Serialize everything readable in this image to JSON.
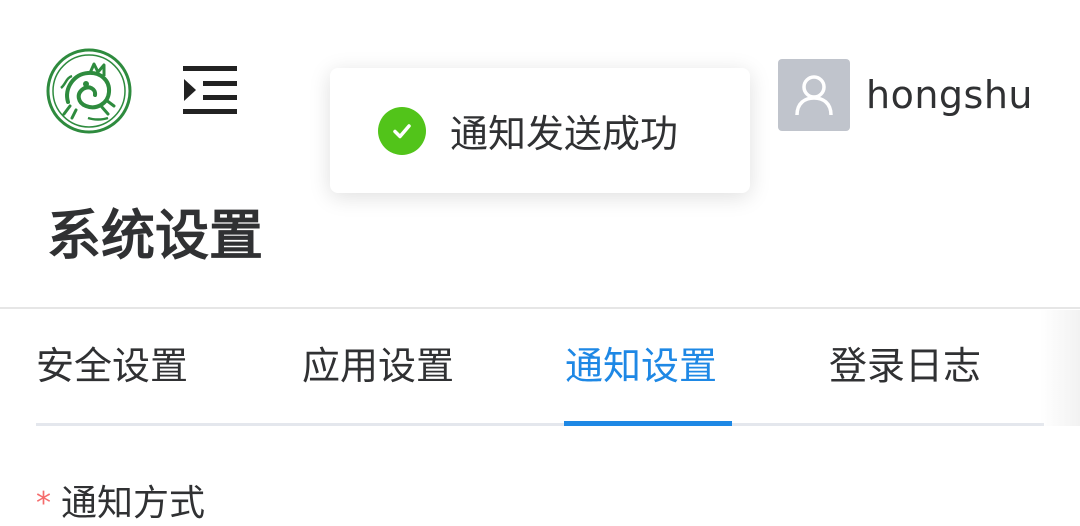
{
  "header": {
    "logo_icon": "dragon-emblem-logo",
    "menu_icon": "menu-unfold-icon",
    "user": {
      "name": "hongshu",
      "avatar_icon": "user-avatar-icon"
    }
  },
  "page": {
    "title": "系统设置"
  },
  "tabs": {
    "items": [
      {
        "label": "安全设置",
        "active": false
      },
      {
        "label": "应用设置",
        "active": false
      },
      {
        "label": "通知设置",
        "active": true
      },
      {
        "label": "登录日志",
        "active": false
      }
    ],
    "active_color": "#1e88e5"
  },
  "form": {
    "required_mark": "*",
    "label": "通知方式"
  },
  "toast": {
    "icon": "success-check-icon",
    "message": "通知发送成功",
    "color": "#52c41a"
  }
}
